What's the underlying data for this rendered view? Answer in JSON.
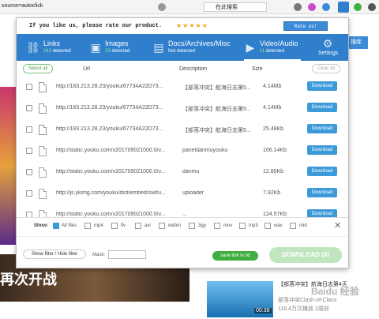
{
  "browser": {
    "url_fragment": "source=autoclick",
    "search_placeholder": "在此搜索"
  },
  "popup": {
    "rate_text": "If you like us, please rate our product.",
    "stars": "★★★★★",
    "rate_button": "Rate us!",
    "tabs": [
      {
        "name": "Links",
        "count": "243",
        "count_suffix": " detected",
        "icon": "link-icon"
      },
      {
        "name": "Images",
        "count": "23",
        "count_suffix": " detected",
        "icon": "image-icon"
      },
      {
        "name": "Docs/Archives/Misc",
        "count": "",
        "count_suffix": "Not detected",
        "icon": "document-icon"
      },
      {
        "name": "Video/Audio",
        "count": "11",
        "count_suffix": " detected",
        "icon": "video-icon"
      },
      {
        "name": "Settings",
        "count": "",
        "count_suffix": "",
        "icon": "gear-icon"
      }
    ],
    "select_all": "Select all",
    "clear_all": "Clear all",
    "columns": {
      "url": "Url",
      "description": "Description",
      "size": "Size"
    },
    "rows": [
      {
        "url": "http://183.213.28.23/youku/67734A22D73...",
        "desc": "【部落冲突】航海日志第5...",
        "size": "4.14Mb",
        "action": "Download",
        "icon": "video-file-icon"
      },
      {
        "url": "http://183.213.28.23/youku/67734A22D73...",
        "desc": "【部落冲突】航海日志第5...",
        "size": "4.14Mb",
        "action": "Download",
        "icon": "video-file-icon"
      },
      {
        "url": "http://183.213.28.23/youku/67734A22D73...",
        "desc": "【部落冲突】航海日志第5...",
        "size": "25.48Kb",
        "action": "Download",
        "icon": "video-file-icon"
      },
      {
        "url": "http://static.youku.com/v201709021000.0/v...",
        "desc": "paneldanmuyouku",
        "size": "106.14Kb",
        "action": "Download",
        "icon": "file-icon"
      },
      {
        "url": "http://static.youku.com/v201709021000.0/v...",
        "desc": "danmu",
        "size": "12.85Kb",
        "action": "Download",
        "icon": "file-icon"
      },
      {
        "url": "http://js.ykimg.com/youku/dist/embed/swf/u...",
        "desc": "uploader",
        "size": "7.92Kb",
        "action": "Download",
        "icon": "file-icon"
      },
      {
        "url": "http://static.youku.com/v201709021000.0/v...",
        "desc": "...",
        "size": "124.57Kb",
        "action": "Download",
        "icon": "file-icon"
      }
    ],
    "filters": {
      "show_label": "Show:",
      "options": [
        {
          "label": "All files",
          "checked": true
        },
        {
          "label": "mp4",
          "checked": false
        },
        {
          "label": "flv",
          "checked": false
        },
        {
          "label": "avi",
          "checked": false
        },
        {
          "label": "webm",
          "checked": false
        },
        {
          "label": "3gp",
          "checked": false
        },
        {
          "label": "mov",
          "checked": false
        },
        {
          "label": "mp3",
          "checked": false
        },
        {
          "label": "wav",
          "checked": false
        },
        {
          "label": "mid",
          "checked": false
        }
      ]
    },
    "show_filter_button": "Show filter / Hide filter",
    "mask_label": "Mask:",
    "save_link_button": "save link in txt",
    "download_button": "DOWNLOAD (0)"
  },
  "background": {
    "banner_text": "再次开战",
    "right_button": "搜库",
    "video_title": "【部落冲突】航海日志第4天",
    "video_duration": "00:38",
    "channel": "部落冲突Clash-of-Clans",
    "views": "116.4万次播放 2周前",
    "watermark": "Baidu 经验"
  },
  "colors": {
    "accent": "#2f7fcc",
    "download": "#3c9ad9",
    "save": "#3fae3f",
    "star": "#f5a623"
  }
}
